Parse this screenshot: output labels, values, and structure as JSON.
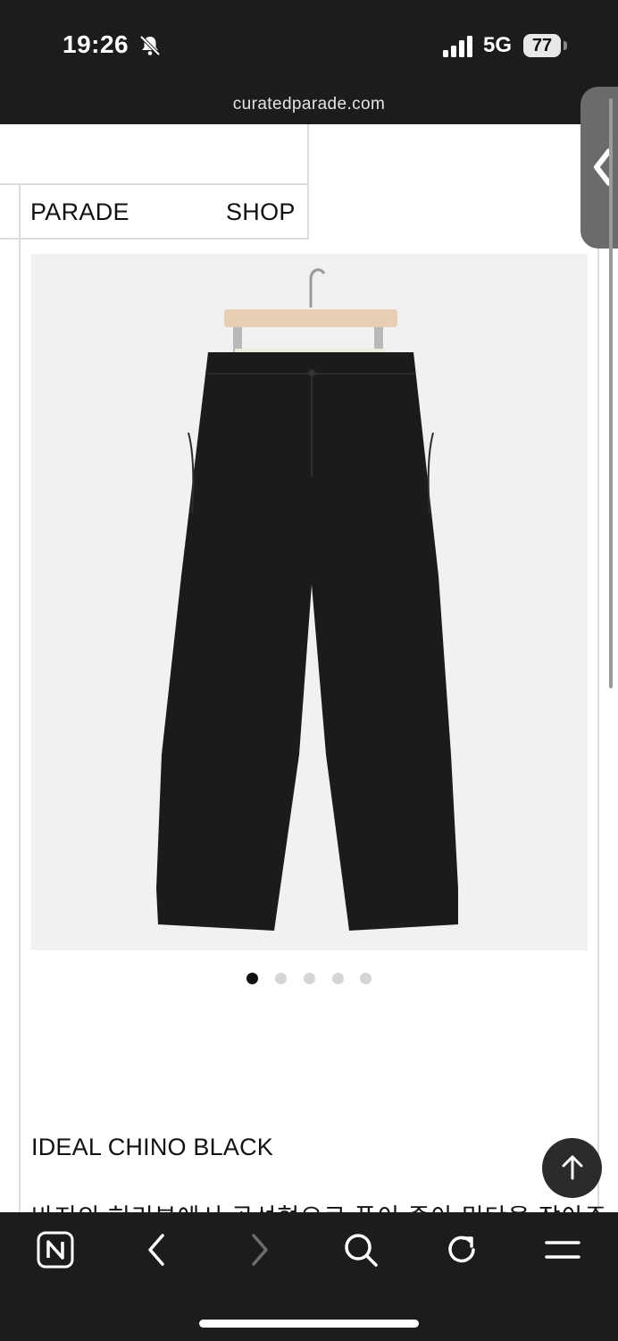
{
  "status_bar": {
    "time": "19:26",
    "network": "5G",
    "battery": "77"
  },
  "browser": {
    "url": "curatedparade.com"
  },
  "nav": {
    "brand": "PARADE",
    "shop": "SHOP"
  },
  "product": {
    "image_count": 5,
    "active_image": 1,
    "name": "IDEAL CHINO BLACK",
    "description_partial": "바지의 허리부에서 곡선형으로 폭이 좁아 밑단을 잡아주"
  },
  "icons": {
    "back_tab": "chevron-left-icon",
    "scroll_top": "arrow-up-icon",
    "toolbar": [
      "n-logo-icon",
      "back-icon",
      "forward-icon",
      "search-icon",
      "reload-icon",
      "menu-icon"
    ]
  },
  "colors": {
    "chrome_bg": "#1c1c1e",
    "page_bg": "#ffffff",
    "photo_bg": "#f1f1f1",
    "pants": "#1a1a1a",
    "hanger_wood": "#e6cfb2"
  }
}
